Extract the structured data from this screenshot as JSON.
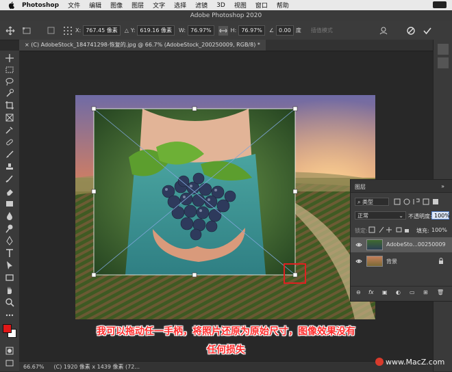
{
  "menubar": {
    "app": "Photoshop",
    "items": [
      "文件",
      "编辑",
      "图像",
      "图层",
      "文字",
      "选择",
      "滤镜",
      "3D",
      "视图",
      "窗口",
      "帮助"
    ]
  },
  "window": {
    "title": "Adobe Photoshop 2020"
  },
  "options": {
    "x_label": "X:",
    "x_value": "767.45 像素",
    "y_label": "Y:",
    "y_value": "619.16 像素",
    "w_label": "W:",
    "w_value": "76.97%",
    "h_label": "H:",
    "h_value": "76.97%",
    "angle_value": "0.00",
    "angle_unit": "度",
    "interp_label": "插值模式"
  },
  "document_tab": {
    "label": "(C) AdobeStock_184741298-恢复的.jpg @ 66.7% (AdobeStock_200250009, RGB/8) *"
  },
  "status": {
    "zoom": "66.67%",
    "info": "(C) 1920 像素 x 1439 像素 (72..."
  },
  "layers_panel": {
    "title": "图层",
    "kind_label": "类型",
    "blend_mode": "正常",
    "opacity_label": "不透明度:",
    "opacity_value": "100%",
    "lock_label": "锁定:",
    "fill_label": "填充:",
    "fill_value": "100%",
    "layers": [
      {
        "name": "AdobeSto...00250009"
      },
      {
        "name": "背景"
      }
    ]
  },
  "caption": {
    "line1": "我可以拖动任一手柄，将照片还原为原始尺寸，图像效果没有",
    "line2": "任何损失"
  },
  "watermark": {
    "text": "www.MacZ.com"
  },
  "colors": {
    "foreground": "#e01818",
    "background": "#ffffff",
    "accent": "#e02020"
  }
}
